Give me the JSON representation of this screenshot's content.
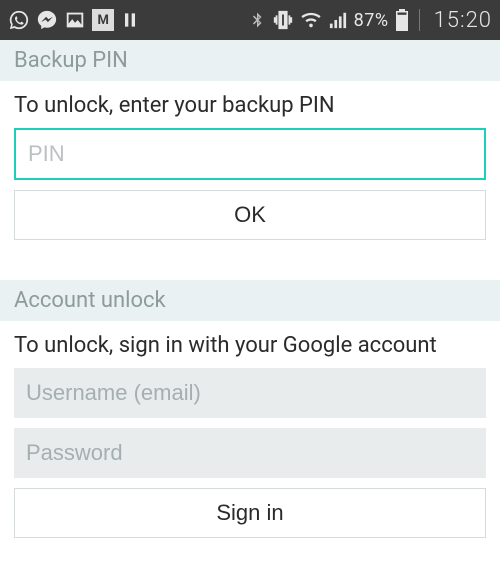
{
  "status": {
    "battery_pct": "87%",
    "time": "15:20"
  },
  "backup_pin": {
    "header": "Backup PIN",
    "prompt": "To unlock, enter your backup PIN",
    "placeholder": "PIN",
    "value": "",
    "ok_label": "OK"
  },
  "account_unlock": {
    "header": "Account unlock",
    "prompt": "To unlock, sign in with your Google account",
    "username_placeholder": "Username (email)",
    "username_value": "",
    "password_placeholder": "Password",
    "password_value": "",
    "signin_label": "Sign in"
  }
}
